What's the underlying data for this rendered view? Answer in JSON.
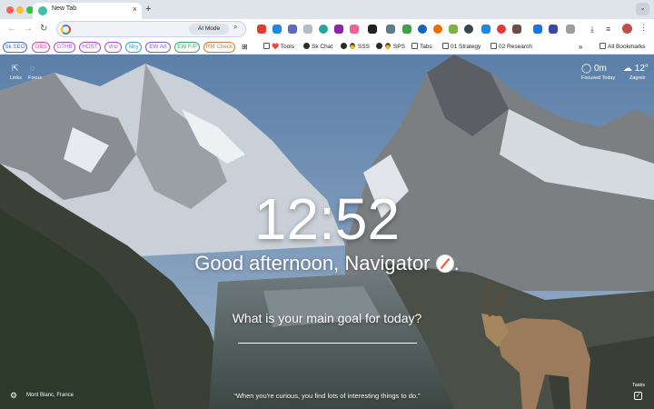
{
  "browser": {
    "tab_title": "New Tab",
    "tab_close_icon": "×",
    "new_tab_icon": "+",
    "tab_search_icon": "⌄"
  },
  "toolbar": {
    "back_icon": "←",
    "forward_icon": "→",
    "reload_icon": "↻",
    "omnibox_value": "",
    "ai_mode_label": "AI Mode",
    "search_icon": "⌕",
    "download_icon": "⤓",
    "menu_icon": "⋮"
  },
  "bookmarks": {
    "chips": [
      {
        "label": "Sk SEO",
        "color": "#4a6fd8"
      },
      {
        "label": "OBS",
        "color": "#d04a9b"
      },
      {
        "label": "GTHB",
        "color": "#9b59d0"
      },
      {
        "label": "HOST",
        "color": "#a84bd0"
      },
      {
        "label": "Vrcl",
        "color": "#b04ad0"
      },
      {
        "label": "Nky",
        "color": "#3b9dd6"
      },
      {
        "label": "EW Art",
        "color": "#7b5cd6"
      },
      {
        "label": "EW F/P",
        "color": "#3aa86a"
      },
      {
        "label": "RM Check",
        "color": "#d07a3a"
      }
    ],
    "items": [
      {
        "label": "❤️ Tools",
        "icon": "folder"
      },
      {
        "label": "Sk Chat",
        "icon": "globe"
      },
      {
        "label": "👨 SSS",
        "icon": "globe"
      },
      {
        "label": "👨 SPS",
        "icon": "globe"
      },
      {
        "label": "Tabs",
        "icon": "folder"
      },
      {
        "label": "01 Strategy",
        "icon": "folder"
      },
      {
        "label": "02 Research",
        "icon": "folder"
      }
    ],
    "overflow": "»",
    "all_bookmarks": "All Bookmarks"
  },
  "dashboard": {
    "links_label": "Links",
    "focus_label": "Focus",
    "focused_value": "0m",
    "focused_label": "Focused Today",
    "temperature": "12°",
    "city": "Zagreb",
    "time": "12:52",
    "greeting": "Good afternoon, Navigator",
    "greeting_end": ".",
    "goal_prompt": "What is your main goal for today?",
    "goal_value": "",
    "location": "Mont Blanc, France",
    "quote": "“When you're curious, you find lots of interesting things to do.”",
    "tasks_label": "Tasks",
    "tasks_icon": "✓"
  },
  "colors": {
    "accent": "#1a73e8",
    "tabbar_bg": "#dfe3ea",
    "sky": "#6b8fb5"
  }
}
